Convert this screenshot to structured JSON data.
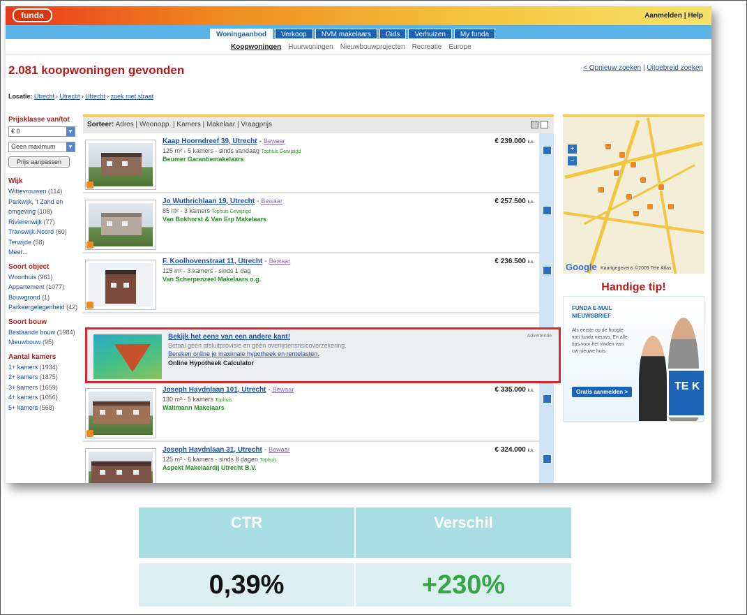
{
  "brand": {
    "logo": "funda"
  },
  "toplinks": {
    "login": "Aanmelden",
    "sep": " | ",
    "help": "Help"
  },
  "maintabs": [
    {
      "label": "Woningaanbod"
    },
    {
      "label": "Verkoop"
    },
    {
      "label": "NVM makelaars"
    },
    {
      "label": "Gids"
    },
    {
      "label": "Verhuizen"
    },
    {
      "label": "My funda"
    }
  ],
  "subtabs": [
    {
      "label": "Koopwoningen"
    },
    {
      "label": "Huurwoningen"
    },
    {
      "label": "Nieuwbouwprojecten"
    },
    {
      "label": "Recreatie"
    },
    {
      "label": "Europe"
    }
  ],
  "heading": "2.081 koopwoningen gevonden",
  "search_links": {
    "new": "< Opnieuw zoeken",
    "sep": " | ",
    "advanced": "Uitgebreid zoeken"
  },
  "location": {
    "label": "Locatie:",
    "crumbs": [
      "Utrecht",
      "Utrecht",
      "Utrecht",
      "zoek met straat"
    ]
  },
  "sidebar": {
    "price_title": "Prijsklasse van/tot",
    "price_from": "€ 0",
    "price_to": "Geen maximum",
    "price_button": "Prijs aanpassen",
    "wijk_title": "Wijk",
    "wijk": [
      {
        "name": "Wittevrouwen",
        "count": "(114)"
      },
      {
        "name": "Parkwijk, 't Zand en omgeving",
        "count": "(108)"
      },
      {
        "name": "Rivierenwijk",
        "count": "(77)"
      },
      {
        "name": "Transwijk-Noord",
        "count": "(60)"
      },
      {
        "name": "Terwijde",
        "count": "(58)"
      },
      {
        "name": "Meer...",
        "count": ""
      }
    ],
    "object_title": "Soort object",
    "object": [
      {
        "name": "Woonhuis",
        "count": "(961)"
      },
      {
        "name": "Appartement",
        "count": "(1077)"
      },
      {
        "name": "Bouwgrond",
        "count": "(1)"
      },
      {
        "name": "Parkeergelegenheid",
        "count": "(42)"
      }
    ],
    "bouw_title": "Soort bouw",
    "bouw": [
      {
        "name": "Bestaande bouw",
        "count": "(1984)"
      },
      {
        "name": "Nieuwbouw",
        "count": "(95)"
      }
    ],
    "kamers_title": "Aantal kamers",
    "kamers": [
      {
        "name": "1+ kamers",
        "count": "(1934)"
      },
      {
        "name": "2+ kamers",
        "count": "(1875)"
      },
      {
        "name": "3+ kamers",
        "count": "(1659)"
      },
      {
        "name": "4+ kamers",
        "count": "(1056)"
      },
      {
        "name": "5+ kamers",
        "count": "(568)"
      }
    ]
  },
  "sortbar": {
    "label": "Sorteer:",
    "options": "Adres | Woonopp. | Kamers | Makelaar | Vraagprijs"
  },
  "listings": [
    {
      "title": "Kaap Hoorndreef 39, Utrecht",
      "save": "Bewaar",
      "info": "125 m² - 5 kamers - sinds vandaag",
      "tag": "Tophuis Gewijzigd",
      "agent": "Beumer Garantiemakelaars",
      "price": "€ 239.000",
      "kk": "k.k."
    },
    {
      "title": "Jo Wuthrichlaan 19, Utrecht",
      "save": "Bewaar",
      "info": "85 m² - 3 kamers",
      "tag": "Tophuis Gewijzigd",
      "agent": "Van Bokhorst & Van Erp Makelaars",
      "price": "€ 257.500",
      "kk": "k.k."
    },
    {
      "title": "F. Koolhovenstraat 11, Utrecht",
      "save": "Bewaar",
      "info": "115 m² - 3 kamers - sinds 1 dag",
      "tag": "",
      "agent": "Van Scherpenzeel Makelaars o.g.",
      "price": "€ 236.500",
      "kk": "k.k."
    },
    {
      "title": "Joseph Haydnlaan 101, Utrecht",
      "save": "Bewaar",
      "info": "130 m² - 5 kamers",
      "tag": "Tophuis",
      "agent": "Waltmann Makelaars",
      "price": "€ 335.000",
      "kk": "k.k."
    },
    {
      "title": "Joseph Haydnlaan 31, Utrecht",
      "save": "Bewaar",
      "info": "125 m² - 6 kamers - sinds 8 dagen",
      "tag": "Tophuis",
      "agent": "Aspekt Makelaardij Utrecht B.V.",
      "price": "€ 324.000",
      "kk": "k.k."
    }
  ],
  "ad": {
    "title": "Bekijk het eens van een andere kant!",
    "label": "Advertentie",
    "line1": "Betaal géén afsluitprovisie en géén overlijdensrisicoverzekering.",
    "line2": "Bereken online je maximale hypotheek en rentelasten.",
    "line3": "Online Hypotheek Calculator"
  },
  "map": {
    "copyright": "Kaartgegevens ©2009 Tele Atlas",
    "google": "Google"
  },
  "tip": {
    "title": "Handige tip!",
    "head1": "FUNDA E-MAIL",
    "head2": "NIEUWSBRIEF",
    "text": "Als eerste op de hoogte van funda nieuws. En alle tips voor het vinden van uw nieuwe huis.",
    "button": "Gratis aanmelden >",
    "sign": "TE K"
  },
  "stats": {
    "ctr_label": "CTR",
    "diff_label": "Verschil",
    "ctr_value": "0,39%",
    "diff_value": "+230%",
    "colors": {
      "header_bg": "#a9dde4",
      "value_bg": "#dcf0f2",
      "positive": "#36a545"
    }
  }
}
